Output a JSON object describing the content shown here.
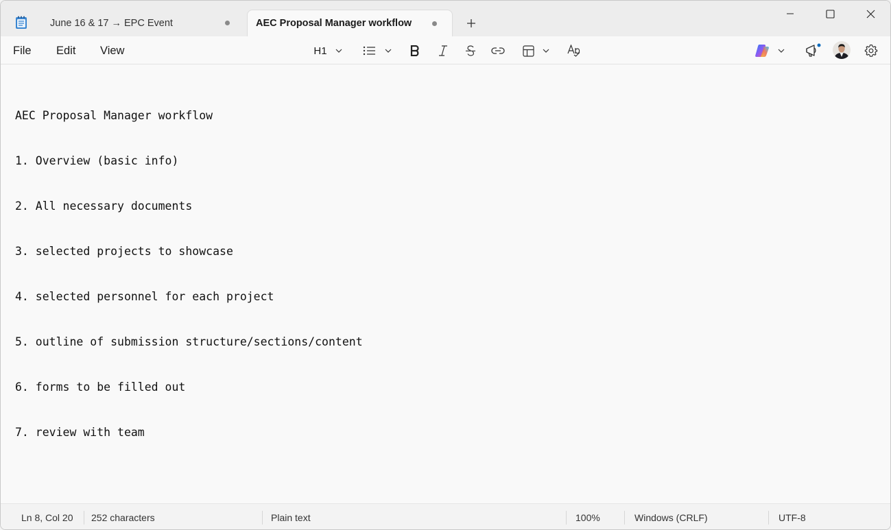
{
  "tabs": [
    {
      "label": "June 16 & 17 → EPC Event",
      "active": false
    },
    {
      "label": "AEC Proposal Manager workflow",
      "active": true
    }
  ],
  "menu": {
    "file": "File",
    "edit": "Edit",
    "view": "View"
  },
  "toolbar": {
    "heading_label": "H1",
    "icons": [
      "list-icon",
      "bold-icon",
      "italic-icon",
      "strikethrough-icon",
      "link-icon",
      "table-icon",
      "spellcheck-icon",
      "copilot-icon",
      "megaphone-icon",
      "avatar",
      "gear-icon"
    ]
  },
  "document": {
    "lines": [
      "AEC Proposal Manager workflow",
      "1. Overview (basic info)",
      "2. All necessary documents",
      "3. selected projects to showcase",
      "4. selected personnel for each project",
      "5. outline of submission structure/sections/content",
      "6. forms to be filled out",
      "7. review with team"
    ]
  },
  "status": {
    "position": "Ln 8, Col 20",
    "characters": "252 characters",
    "format": "Plain text",
    "zoom": "100%",
    "line_ending": "Windows (CRLF)",
    "encoding": "UTF-8"
  },
  "colors": {
    "accent_dot": "#0f6cbd",
    "tab_dot": "#8a8a8a"
  }
}
